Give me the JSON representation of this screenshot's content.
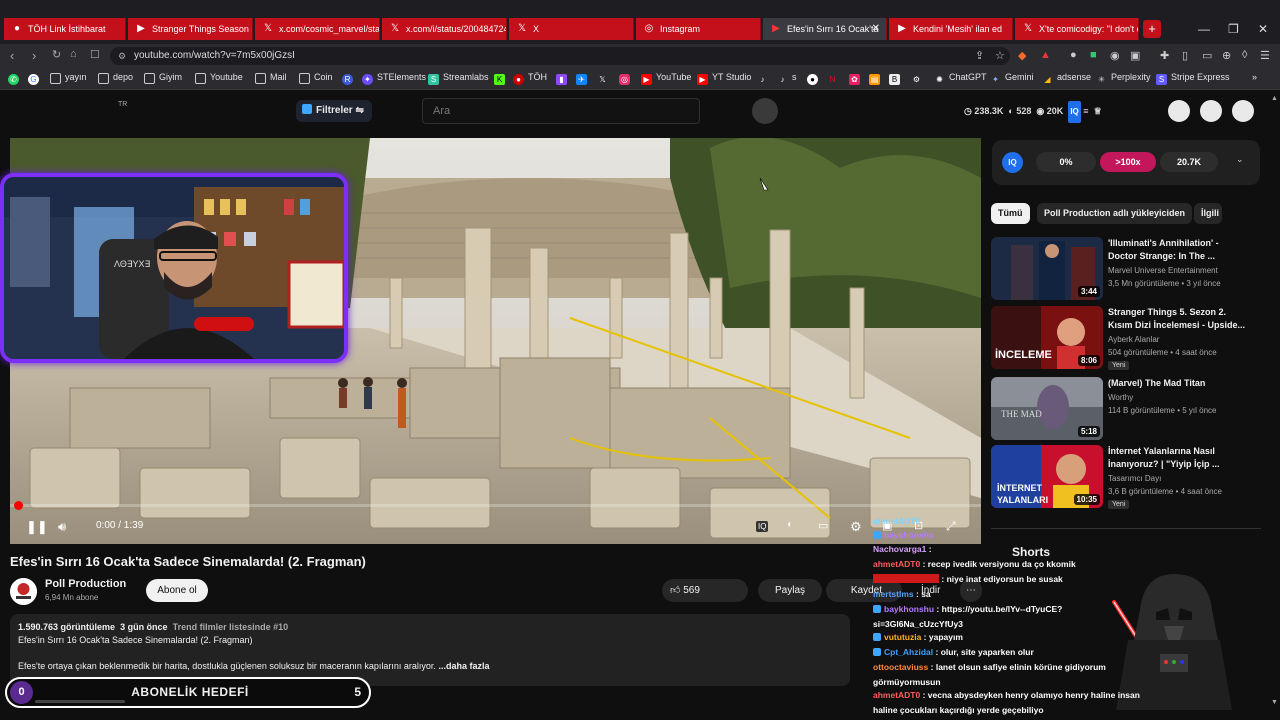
{
  "browser": {
    "tabs": [
      {
        "label": "TÖH Link İstihbarat",
        "icon": "red-circle-icon"
      },
      {
        "label": "Stranger Things Season 5",
        "icon": "youtube-icon"
      },
      {
        "label": "x.com/cosmic_marvel/stat",
        "icon": "x-icon"
      },
      {
        "label": "x.com/i/status/200484724",
        "icon": "x-icon"
      },
      {
        "label": "X",
        "icon": "x-icon"
      },
      {
        "label": "Instagram",
        "icon": "instagram-icon"
      },
      {
        "label": "Efes'in Sırrı 16 Ocak'ta",
        "icon": "youtube-icon",
        "active": true
      },
      {
        "label": "Kendini 'Mesih' ilan ed",
        "icon": "youtube-icon"
      },
      {
        "label": "X'te comicodigy: \"I don't c",
        "icon": "x-icon"
      }
    ],
    "url": "youtube.com/watch?v=7m5x00jGzsI",
    "bookmarks": [
      "yayın",
      "depo",
      "Giyim",
      "Youtube",
      "Mail",
      "Coin",
      "STElements",
      "Streamlabs",
      "TÖH",
      "YouTube",
      "YT Studio",
      "s",
      "ChatGPT",
      "Gemini",
      "adsense",
      "Perplexity",
      "Stripe Express"
    ]
  },
  "topbar": {
    "locale": "TR",
    "filters_label": "Filtreler",
    "search_placeholder": "Ara",
    "stat_views": "238.3K",
    "stat_likes": "528",
    "stat_comments": "20K"
  },
  "player": {
    "time": "0:00 / 1:39",
    "progress": 0.0
  },
  "video": {
    "title": "Efes'in Sırrı 16 Ocak'ta Sadece Sinemalarda! (2. Fragman)",
    "channel": "Poll Production",
    "subscribers": "6,94 Mn abone",
    "subscribe_label": "Abone ol",
    "likes": "569",
    "share_label": "Paylaş",
    "save_label": "Kaydet",
    "download_label": "İndir",
    "views_line": "1.590.763 görüntüleme",
    "ago": "3 gün önce",
    "trend": "Trend filmler listesinde #10",
    "desc_line1": "Efes'in Sırrı 16 Ocak'ta Sadece Sinemalarda! (2. Fragman)",
    "desc_line2": "Efes'te ortaya çıkan beklenmedik bir harita, dostlukla güçlenen soluksuz bir maceranın kapılarını aralıyor.",
    "more": "...daha fazla"
  },
  "goal": {
    "current": "0",
    "label": "ABONELİK HEDEFİ",
    "target": "5"
  },
  "iq_bar": {
    "a": "0%",
    "b": ">100x",
    "c": "20.7K"
  },
  "chips": [
    "Tümü",
    "Poll Production adlı yükleyiciden",
    "İlgili"
  ],
  "related": [
    {
      "title": "'Illuminati's Annihilation' - Doctor Strange: In The ...",
      "channel": "Marvel Universe Entertainment",
      "meta": "3,5 Mn görüntüleme • 3 yıl önce",
      "duration": "3:44",
      "new": ""
    },
    {
      "title": "Stranger Things 5. Sezon 2. Kısım Dizi İncelemesi - Upside...",
      "channel": "Ayberk Alanlar",
      "meta": "504 görüntüleme • 4 saat önce",
      "duration": "8:06",
      "new": "Yeni"
    },
    {
      "title": "(Marvel) The Mad Titan",
      "channel": "Worthy",
      "meta": "114 B görüntüleme • 5 yıl önce",
      "duration": "5:18",
      "new": ""
    },
    {
      "title": "İnternet Yalanlarına Nasıl İnanıyoruz? | \"Yiyip İçip ...",
      "channel": "Tasarımcı Dayı",
      "meta": "3,6 B görüntüleme • 4 saat önce",
      "duration": "10:35",
      "new": "Yeni"
    }
  ],
  "shorts_label": "Shorts",
  "chat": [
    {
      "user": "ahmetADT0",
      "color": "#7fd4ff",
      "text": ""
    },
    {
      "user": "baykhonshu",
      "color": "#b77bff",
      "text": ""
    },
    {
      "user": "Nachovarga1",
      "color": "#d4a0ff",
      "text": ""
    },
    {
      "user": "ahmetADT0",
      "color": "#ff5c5c",
      "text": "recep ivedik versiyonu da ço kkomik"
    },
    {
      "user": "",
      "color": "#ff3b3b",
      "text": "niye inat ediyorsun be susak"
    },
    {
      "user": "mertstlms",
      "color": "#4fa3ff",
      "text": "sa"
    },
    {
      "user": "baykhonshu",
      "color": "#b77bff",
      "text": "https://youtu.be/lYv--dTyuCE?si=3Gl6Na_cUzcYfUy3"
    },
    {
      "user": "vututuzia",
      "color": "#ffb020",
      "text": "yapayım"
    },
    {
      "user": "Cpt_Ahzidal",
      "color": "#3fa0ff",
      "text": "olur, site yaparken olur"
    },
    {
      "user": "ottooctaviuss",
      "color": "#ff8a3d",
      "text": "lanet olsun safiye elinin körüne gidiyorum görmüyormusun"
    },
    {
      "user": "ahmetADT0",
      "color": "#ff5c5c",
      "text": "vecna abysdeyken henry olamıyo henry haline insan haline çocukları kaçırdığı yerde geçebiliyo"
    }
  ]
}
